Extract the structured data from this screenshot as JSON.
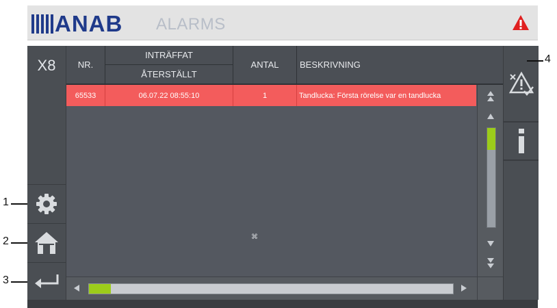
{
  "header": {
    "logo_text": "ANAB",
    "title": "ALARMS",
    "warning_icon": "warning-triangle-icon",
    "brand_color": "#1f3a8a",
    "warning_color": "#e02020"
  },
  "side": {
    "unit_label": "X8",
    "buttons": [
      {
        "icon": "gear-icon"
      },
      {
        "icon": "home-icon"
      },
      {
        "icon": "back-arrow-icon"
      }
    ]
  },
  "table": {
    "headers": {
      "nr": "NR.",
      "occurred": "INTRÄFFAT",
      "reset": "ÅTERSTÄLLT",
      "count": "ANTAL",
      "description": "BESKRIVNING"
    },
    "rows": [
      {
        "nr": "65533",
        "time": "06.07.22  08:55:10",
        "count": "1",
        "description": "Tandlucka: Första rörelse var en tandlucka",
        "color": "#f35c5c"
      }
    ],
    "center_mark": "⌘"
  },
  "scrollbars": {
    "vertical_position": 0,
    "horizontal_position": 0,
    "thumb_color": "#9ccc1a"
  },
  "right": {
    "buttons": [
      {
        "icon": "acknowledge-alarm-icon"
      },
      {
        "icon": "info-icon"
      }
    ]
  },
  "callouts": {
    "c1": "1",
    "c2": "2",
    "c3": "3",
    "c4": "4"
  }
}
